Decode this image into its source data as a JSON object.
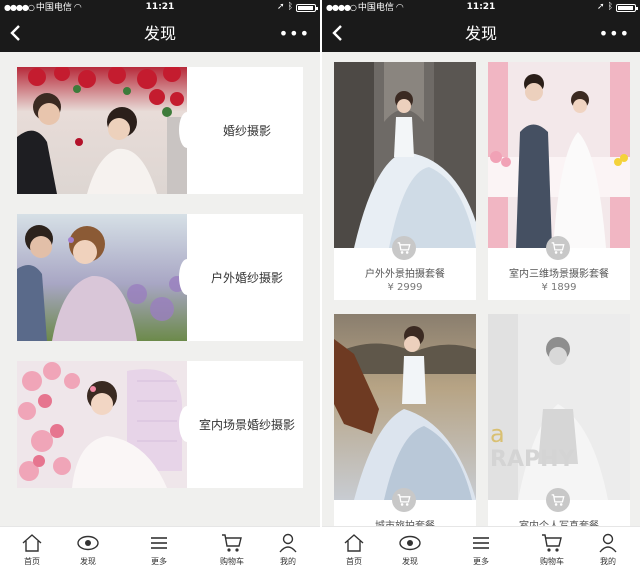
{
  "status_bar": {
    "carrier": "中国电信",
    "time": "11:21"
  },
  "nav": {
    "title": "发现",
    "more_label": "•••"
  },
  "left_screen": {
    "categories": [
      {
        "label": "婚纱摄影"
      },
      {
        "label": "户外婚纱摄影"
      },
      {
        "label": "室内场景婚纱摄影"
      }
    ]
  },
  "right_screen": {
    "products": [
      {
        "name": "户外外景拍摄套餐",
        "price": "¥ 2999"
      },
      {
        "name": "室内三维场景摄影套餐",
        "price": "¥ 1899"
      },
      {
        "name": "城市旅拍套餐",
        "price": ""
      },
      {
        "name": "室内个人写真套餐",
        "price": ""
      }
    ],
    "watermark_text": "a RAPHY"
  },
  "tab_bar": {
    "items": [
      {
        "label": "首页",
        "icon": "home-icon"
      },
      {
        "label": "发现",
        "icon": "eye-icon"
      },
      {
        "label": "更多",
        "icon": "menu-icon"
      },
      {
        "label": "购物车",
        "icon": "cart-icon"
      },
      {
        "label": "我的",
        "icon": "user-icon"
      }
    ]
  },
  "colors": {
    "nav_bg": "#1a1a1a",
    "page_bg": "#f0f0ee",
    "card_bg": "#ffffff"
  }
}
